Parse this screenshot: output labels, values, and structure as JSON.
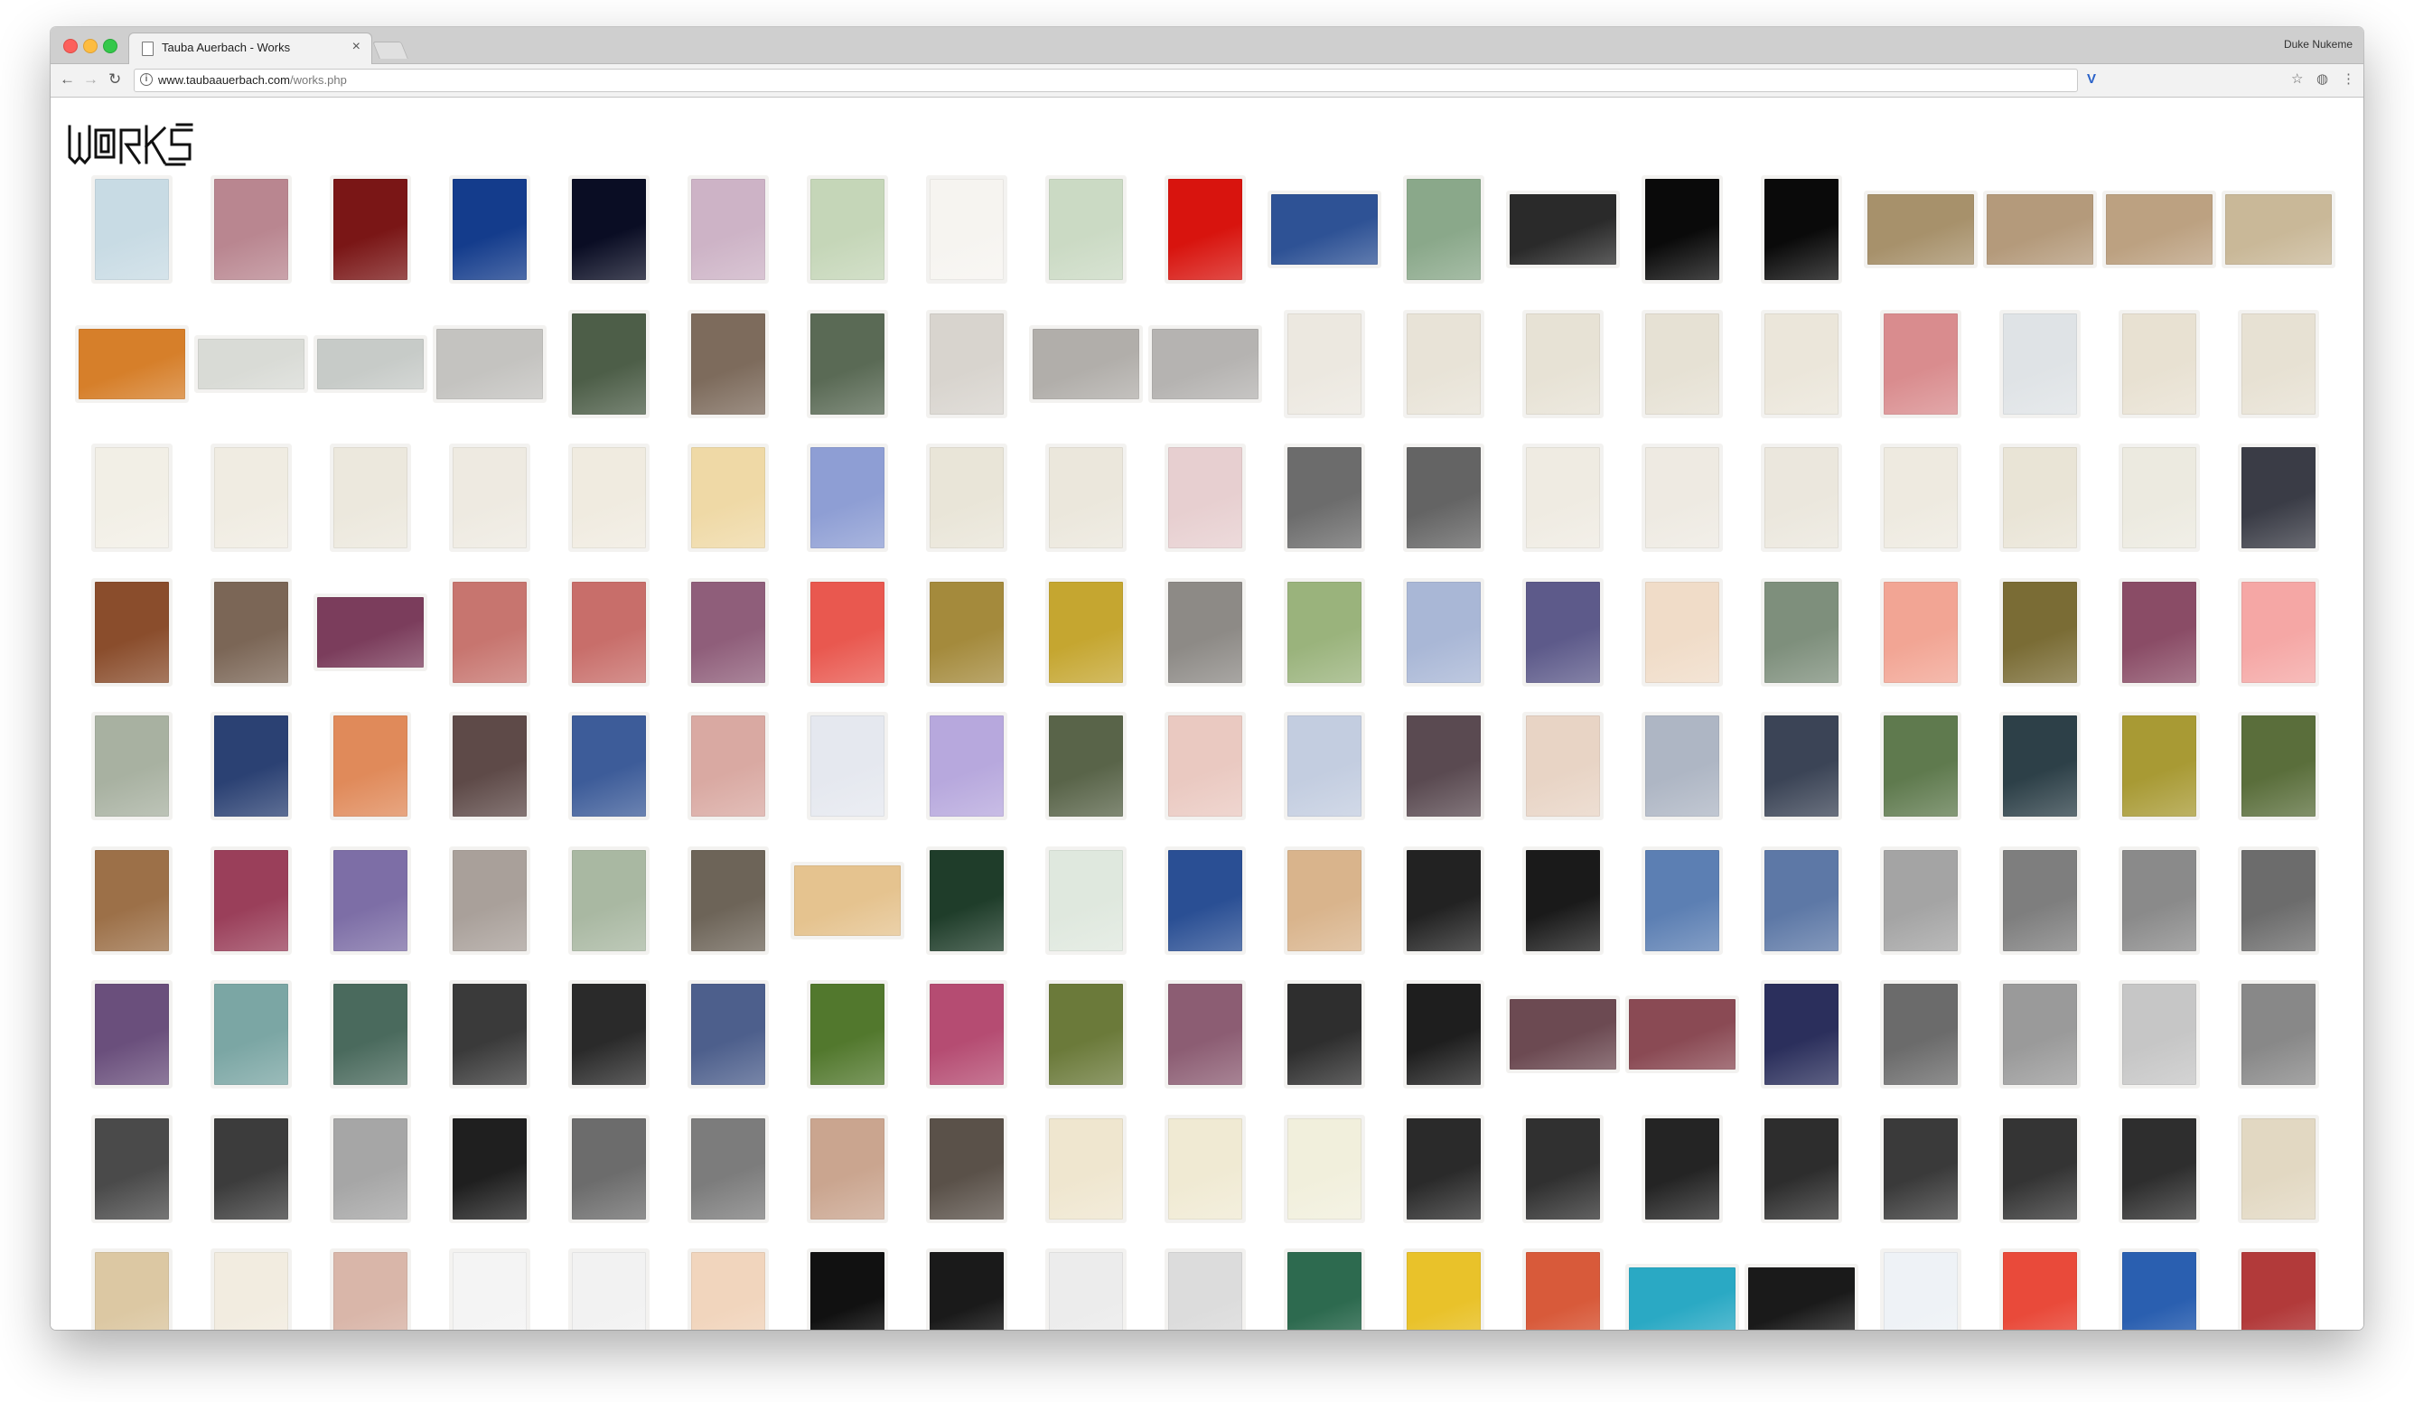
{
  "browser": {
    "tab_title": "Tauba Auerbach - Works",
    "profile_name": "Duke Nukeme",
    "url_host": "www.taubaauerbach.com",
    "url_path": "/works.php",
    "icons": [
      "back-arrow-icon",
      "forward-arrow-icon",
      "reload-icon",
      "info-icon",
      "extension-v-icon",
      "bookmark-star-icon",
      "extension-icon",
      "menu-icon"
    ]
  },
  "page": {
    "logo_text": "WORKS",
    "grid_rows": [
      [
        "#c8dbe4",
        "#b98690",
        "#7a1616",
        "#143c8c",
        "#0a0d24",
        "#cdb3c6",
        "#c5d6b8",
        "#f6f4f0",
        "#cbdac4",
        "#d8140e",
        "#2e5295",
        "#8aa88a",
        "#2a2a2a",
        "#0a0a0a",
        "#0a0a0a",
        "#a7916b",
        "#b49a7b",
        "#bca181",
        "#c9b898"
      ],
      [
        "#d67f2a",
        "#d9dbd6",
        "#c7cbc8",
        "#c4c3c0",
        "#4d5e48",
        "#7d6b5c",
        "#5a6a55",
        "#d8d4ce",
        "#b1aeaa",
        "#b5b3b1",
        "#ece8e0",
        "#e8e3d7",
        "#e7e2d5",
        "#e6e1d4",
        "#ebe6da",
        "#d98c8e",
        "#dfe3e6",
        "#e8e1d2",
        "#e7e1d3"
      ],
      [
        "#f2efe6",
        "#f0ece2",
        "#ece8dd",
        "#eeeae1",
        "#f0ebe0",
        "#efd9a6",
        "#8e9ed4",
        "#e9e5d8",
        "#ebe7dc",
        "#e7cfd0",
        "#6c6c6c",
        "#646464",
        "#efebe2",
        "#eeeae2",
        "#ebe7dd",
        "#eeeae0",
        "#e9e4d6",
        "#eceae0",
        "#3a3c46"
      ],
      [
        "#8a4d2c",
        "#7b6656",
        "#7b3d5c",
        "#c7756f",
        "#c86e6a",
        "#8f5e7a",
        "#e9584f",
        "#a48a3c",
        "#c5a630",
        "#8d8a86",
        "#9ab37c",
        "#a9b7d6",
        "#5d5a8a",
        "#f0dcc8",
        "#7e8f7c",
        "#f2a594",
        "#7a6c35",
        "#8a4c66",
        "#f5a7a5"
      ],
      [
        "#a8b1a1",
        "#2b4173",
        "#e08a5a",
        "#5e4a48",
        "#3d5c99",
        "#d9a9a2",
        "#e5e8ef",
        "#b7a8dd",
        "#596449",
        "#eac9c1",
        "#c3cde0",
        "#5a4a51",
        "#e8d4c5",
        "#aeb6c4",
        "#3b4456",
        "#5f7a4e",
        "#2d4048",
        "#a89a34",
        "#5a6e3b"
      ],
      [
        "#9c7048",
        "#9a3f5a",
        "#7d6ea6",
        "#a9a09a",
        "#a9b8a2",
        "#6d6458",
        "#e5c38f",
        "#1f3d2a",
        "#dfe8de",
        "#2a4f94",
        "#d9b48c",
        "#222222",
        "#1a1a1a",
        "#5c7fb3",
        "#5d78a6",
        "#a4a4a4",
        "#7e7e7e",
        "#8a8a8a",
        "#6c6c6c"
      ],
      [
        "#6a4f7c",
        "#7ba6a4",
        "#4a6a5d",
        "#3a3a3a",
        "#2a2a2a",
        "#4d5f8c",
        "#52782d",
        "#b54c72",
        "#6b7a3a",
        "#8c5d73",
        "#2e2e2e",
        "#1e1e1e",
        "#6c4a52",
        "#8a4a54",
        "#2b2f5c",
        "#6b6b6b",
        "#9a9a9a",
        "#c6c6c6",
        "#888888"
      ],
      [
        "#4a4a4a",
        "#3c3c3c",
        "#a6a6a6",
        "#1f1f1f",
        "#6c6c6c",
        "#7c7c7c",
        "#caa58f",
        "#5a5149",
        "#efe6cf",
        "#f0ead3",
        "#f1efdc",
        "#2a2a2a",
        "#303030",
        "#242424",
        "#2d2d2d",
        "#3a3a3a",
        "#343434",
        "#2e2e2e",
        "#e2d8c2"
      ],
      [
        "#dcc8a3",
        "#f2ece0",
        "#d9b6a9",
        "#f4f4f4",
        "#f2f2f2",
        "#f1d5bd",
        "#111111",
        "#1a1a1a",
        "#ececec",
        "#dcdcdc",
        "#2d6a4f",
        "#e9c22a",
        "#d85a3a",
        "#2aa9c4",
        "#1a1a1a",
        "#eef2f6",
        "#e94a3a",
        "#2a5fb0",
        "#b23a3a"
      ]
    ]
  }
}
